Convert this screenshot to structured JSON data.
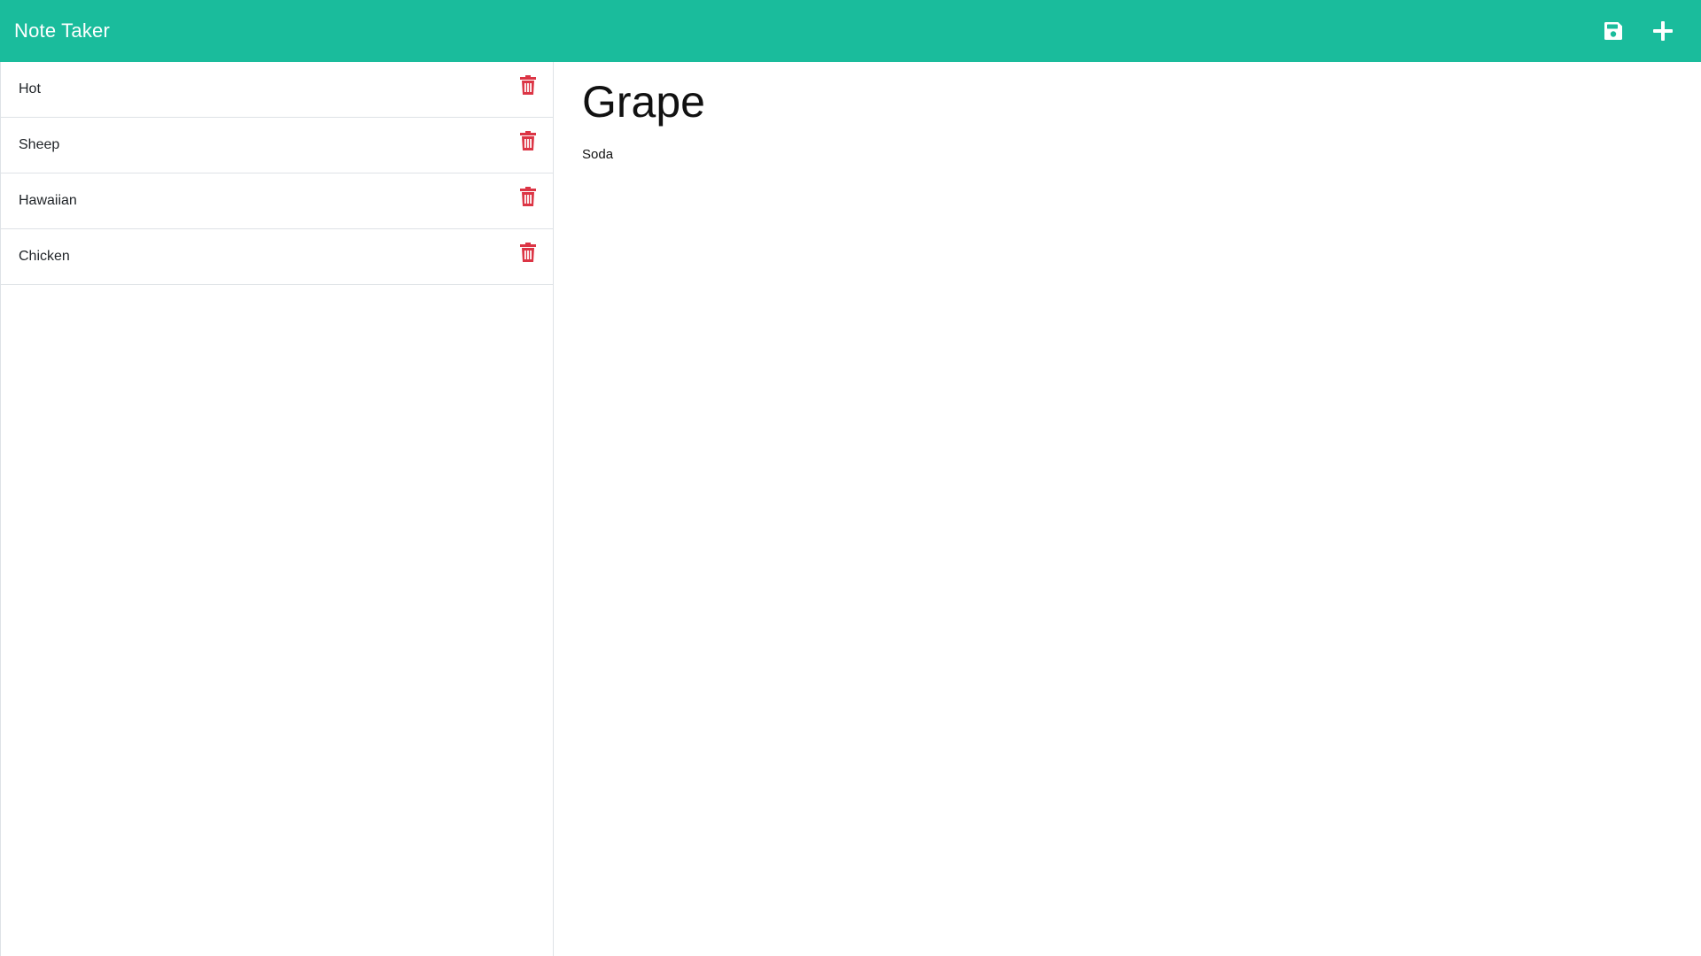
{
  "app": {
    "title": "Note Taker"
  },
  "navbar": {
    "save_icon": "floppy-save-icon",
    "new_icon": "plus-icon",
    "background_color": "#1abc9c"
  },
  "notes": [
    {
      "title": "Hot"
    },
    {
      "title": "Sheep"
    },
    {
      "title": "Hawaiian"
    },
    {
      "title": "Chicken"
    }
  ],
  "delete_icon": {
    "name": "trash-icon",
    "color": "#dc3545"
  },
  "editor": {
    "title_value": "Grape",
    "text_value": "Soda"
  }
}
